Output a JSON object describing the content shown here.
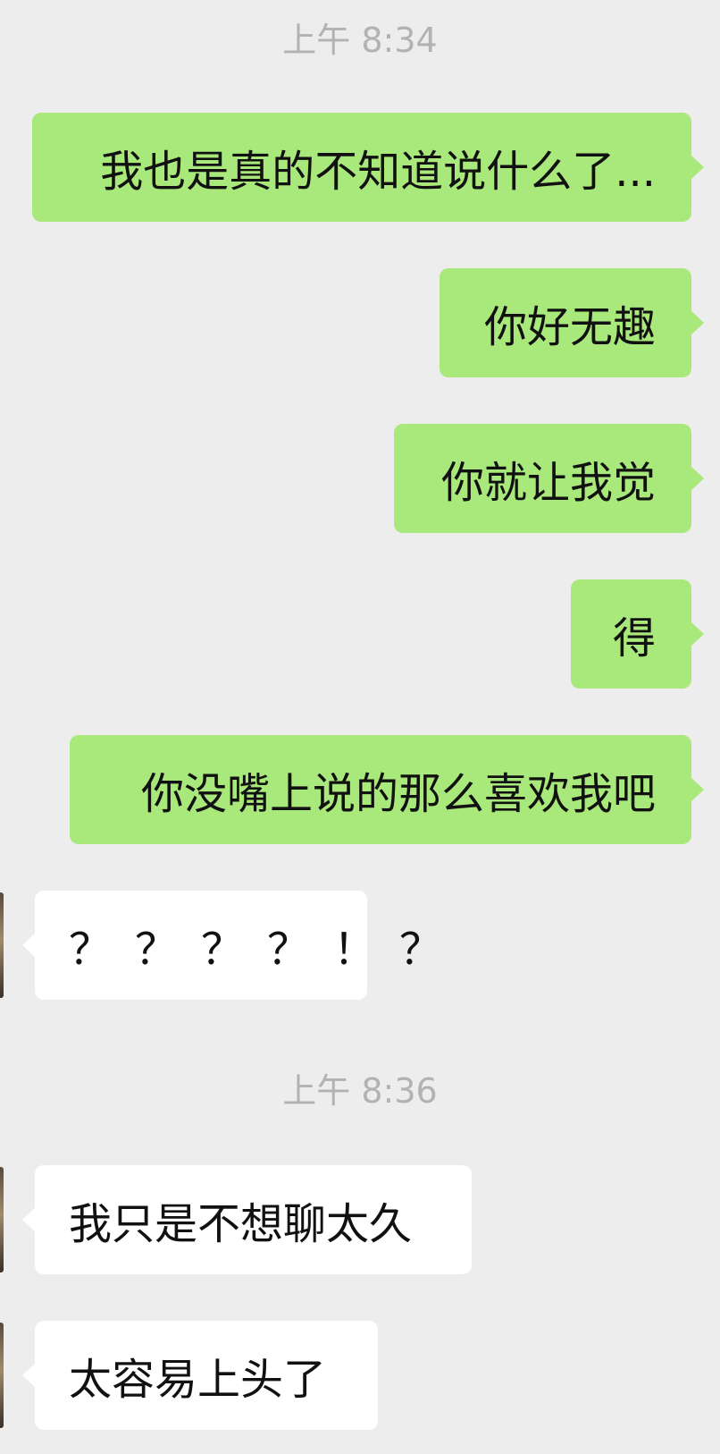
{
  "chat": {
    "timestamps": [
      "上午 8:34",
      "上午 8:36"
    ],
    "messages": [
      {
        "sender": "me",
        "text": "我也是真的不知道说什么了..."
      },
      {
        "sender": "me",
        "text": "你好无趣"
      },
      {
        "sender": "me",
        "text": "你就让我觉"
      },
      {
        "sender": "me",
        "text": "得"
      },
      {
        "sender": "me",
        "text": "你没嘴上说的那么喜欢我吧"
      },
      {
        "sender": "other",
        "text": "？？？？！？"
      },
      {
        "sender": "other",
        "text": "我只是不想聊太久"
      },
      {
        "sender": "other",
        "text": "太容易上头了"
      }
    ]
  },
  "colors": {
    "background": "#ededed",
    "sent_bubble": "#a9e87b",
    "received_bubble": "#ffffff",
    "timestamp_text": "#b2b2b2",
    "message_text": "#111111"
  }
}
